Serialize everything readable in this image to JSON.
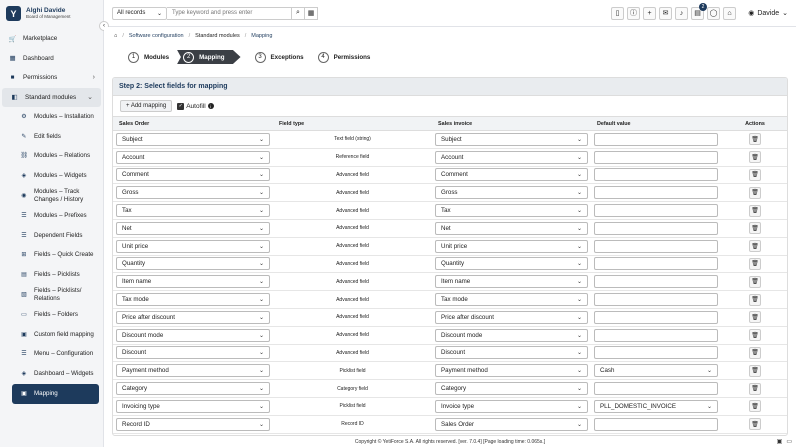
{
  "brand": {
    "name": "Alghi Davide",
    "role": "Board of Management",
    "logo": "Y"
  },
  "nav": {
    "items": [
      {
        "label": "Marketplace",
        "icon": "cart-icon"
      },
      {
        "label": "Dashboard",
        "icon": "dashboard-icon"
      },
      {
        "label": "Permissions",
        "icon": "briefcase-icon"
      },
      {
        "label": "Standard modules",
        "icon": "cube-icon"
      }
    ],
    "sub_items": [
      "Modules – Installation",
      "Edit fields",
      "Modules – Relations",
      "Modules – Widgets",
      "Modules – Track Changes / History",
      "Modules – Prefixes",
      "Dependent Fields",
      "Fields – Quick Create",
      "Fields – Picklists",
      "Fields – Picklists/ Relations",
      "Fields – Folders",
      "Custom field mapping",
      "Menu – Configuration",
      "Dashboard – Widgets",
      "Mapping"
    ]
  },
  "topbar": {
    "search_module": "All records",
    "search_placeholder": "Type keyword and press enter",
    "badge_count": "2",
    "user": "Davide"
  },
  "breadcrumb": [
    "Software configuration",
    "Standard modules",
    "Mapping"
  ],
  "steps": [
    {
      "num": "1",
      "label": "Modules"
    },
    {
      "num": "2",
      "label": "Mapping"
    },
    {
      "num": "3",
      "label": "Exceptions"
    },
    {
      "num": "4",
      "label": "Permissions"
    }
  ],
  "panel": {
    "title": "Step 2: Select fields for mapping",
    "add_label": "+ Add mapping",
    "autofill_label": "Autofill"
  },
  "table": {
    "headers": [
      "Sales Order",
      "Field type",
      "Sales invoice",
      "Default value",
      "Actions"
    ],
    "rows": [
      {
        "src": "Subject",
        "type": "Text field (string)",
        "dst": "Subject",
        "def": ""
      },
      {
        "src": "Account",
        "type": "Reference field",
        "dst": "Account",
        "def": ""
      },
      {
        "src": "Comment",
        "type": "Advanced field",
        "dst": "Comment",
        "def": ""
      },
      {
        "src": "Gross",
        "type": "Advanced field",
        "dst": "Gross",
        "def": ""
      },
      {
        "src": "Tax",
        "type": "Advanced field",
        "dst": "Tax",
        "def": ""
      },
      {
        "src": "Net",
        "type": "Advanced field",
        "dst": "Net",
        "def": ""
      },
      {
        "src": "Unit price",
        "type": "Advanced field",
        "dst": "Unit price",
        "def": ""
      },
      {
        "src": "Quantity",
        "type": "Advanced field",
        "dst": "Quantity",
        "def": ""
      },
      {
        "src": "Item name",
        "type": "Advanced field",
        "dst": "Item name",
        "def": ""
      },
      {
        "src": "Tax mode",
        "type": "Advanced field",
        "dst": "Tax mode",
        "def": ""
      },
      {
        "src": "Price after discount",
        "type": "Advanced field",
        "dst": "Price after discount",
        "def": ""
      },
      {
        "src": "Discount mode",
        "type": "Advanced field",
        "dst": "Discount mode",
        "def": ""
      },
      {
        "src": "Discount",
        "type": "Advanced field",
        "dst": "Discount",
        "def": ""
      },
      {
        "src": "Payment method",
        "type": "Picklist field",
        "dst": "Payment method",
        "def": "Cash"
      },
      {
        "src": "Category",
        "type": "Category field",
        "dst": "Category",
        "def": ""
      },
      {
        "src": "Invoicing type",
        "type": "Picklist field",
        "dst": "Invoice type",
        "def": "PLL_DOMESTIC_INVOICE"
      },
      {
        "src": "Record ID",
        "type": "Record ID",
        "dst": "Sales Order",
        "def": ""
      }
    ]
  },
  "footer": {
    "text": "Copyright © YetiForce S.A. All rights reserved. [ver. 7.0.4] [Page loading time: 0.065s.]"
  }
}
